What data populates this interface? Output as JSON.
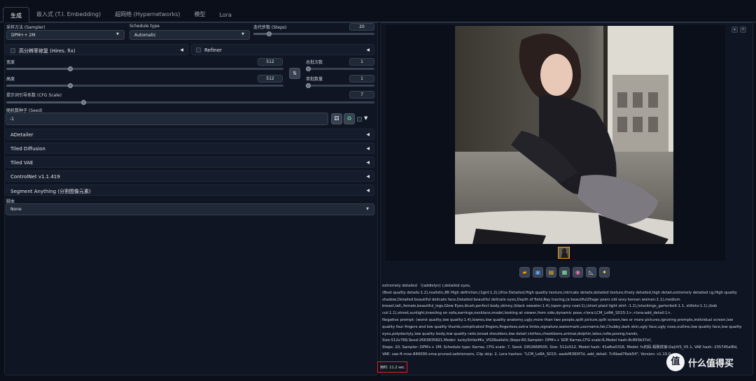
{
  "tabs": [
    "生成",
    "嵌入式 (T.I. Embedding)",
    "超网络 (Hypernetworks)",
    "模型",
    "Lora"
  ],
  "sampler": {
    "label": "采样方法 (Sampler)",
    "value": "DPM++ 2M"
  },
  "schedule": {
    "label": "Schedule type",
    "value": "Automatic"
  },
  "steps": {
    "label": "迭代步数 (Steps)",
    "value": "20",
    "fraction": 0.13
  },
  "hires": {
    "label": "高分辨率修复 (Hires. fix)"
  },
  "refiner": {
    "label": "Refiner"
  },
  "width": {
    "label": "宽度",
    "value": "512",
    "fraction": 0.23
  },
  "height": {
    "label": "高度",
    "value": "512",
    "fraction": 0.23
  },
  "swap_icon": "swap-icon",
  "batch_count": {
    "label": "总批次数",
    "value": "1",
    "fraction": 0.0
  },
  "batch_size": {
    "label": "单批数量",
    "value": "1",
    "fraction": 0.0
  },
  "cfg": {
    "label": "提示词引导系数 (CFG Scale)",
    "value": "7",
    "fraction": 0.21
  },
  "seed": {
    "label": "随机数种子 (Seed)",
    "value": "-1"
  },
  "accordions": [
    "ADetailer",
    "Tiled Diffusion",
    "Tiled VAE",
    "ControlNet v1.1.419",
    "Segment Anything (分割图像元素)"
  ],
  "script": {
    "label": "脚本",
    "value": "None"
  },
  "info": [
    "extremely detailed （(addielyn) ),detailed eyes,",
    "(Best quality details:1.2),realistic,8K High definition,(1girl:1.2),Ultra Detailed,High quality texture,intricate details,detailed texture,finely detailed,high detail,extremely detailed cg,High quality shadow,Detailed beautiful delicate face,Detailed beautiful delicate eyes,Depth of field,Ray tracing,(a beautiful25age years old sexy korean woman:1.1),medium breast,tall,,female,beautiful_legs,Glow Eyes,blush,perfect body,skinny,(black sweater:1.4),(open grey coat:1),(short plaid tight skirt :1.2),(stockings_garterbelt:1.1, stilleto:1.1),(bob cut:1.1),street,sunlight,kneeling on sofa,earrings,necklace,model,looking at viewer,from side,dynamic pose,<lora:LCM_LoRA_SD15:1>,<lora:add_detail:1>,",
    "Negative prompt: (worst quality,low quality:1.4),lowres,low quality anatomy,ugly,more than two people,split picture,split screen,two or more pictures,ignoring prompts,individual screen,low quality four fingers and low quality thumb,complicated fingers,fingerless,extra limbs,signature,watermark,username,fat,Chubby,dark skin,ugly face,ugly nose,outline,low quality face,low quality eyes,polydactyly,low quality body,low quality ratio,broad shoulders,low detail clothes,cheekbone,animal,dolphin,latex,nsfw,posing,hands,",
    "Size:512x768,Seed:2663835821,Model: luckyStrikeMix_V02Realistic,Steps:60,Sampler: DPM++ SDE Karras,CFG scale:6,Model hash:8c893b37ef,",
    "Steps: 20, Sampler: DPM++ 2M, Schedule type: Karras, CFG scale: 7, Seed: 2952668500, Size: 512x512, Model hash: 41afba5316, Model: fc的妈-极致拼接-DajiiVS_V5.1, VAE hash: 235745af8d, VAE: vae-ft-mse-840000-ema-pruned.safetensors, Clip skip: 2, Lora hashes: \"LCM_LoRA_SD15: aaebf6360f7d, add_detail: 7c6bad76eb54\", Version: v1.10.0"
  ],
  "time": "用时: 11.2 sec.",
  "toolbar_icons": [
    "folder-icon",
    "save-icon",
    "zip-icon",
    "image-icon",
    "palette-icon",
    "ruler-icon",
    "sparkle-icon"
  ],
  "watermark": {
    "logo": "值",
    "text": "什么值得买"
  }
}
